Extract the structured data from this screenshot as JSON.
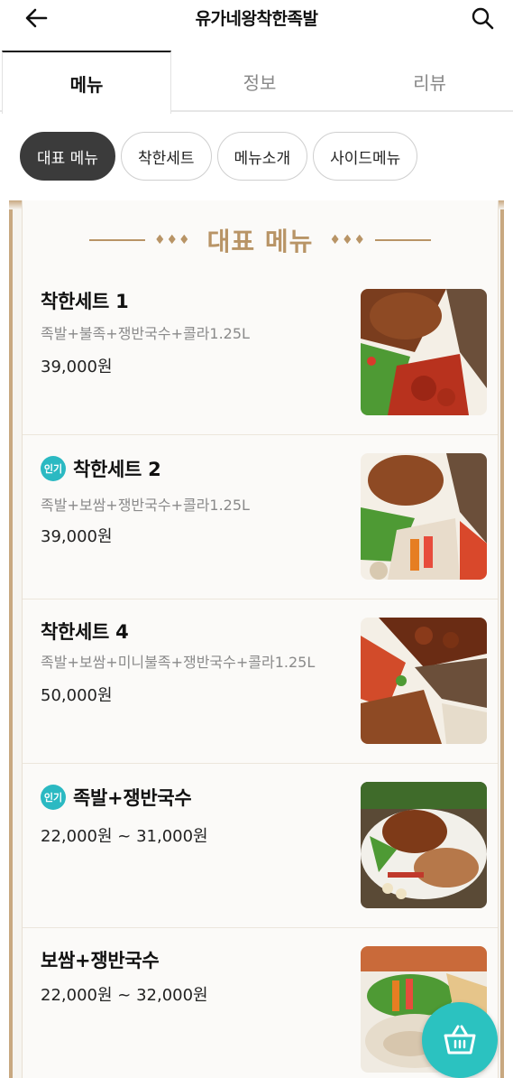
{
  "header": {
    "title": "유가네왕착한족발"
  },
  "tabs": [
    {
      "label": "메뉴",
      "active": true
    },
    {
      "label": "정보",
      "active": false
    },
    {
      "label": "리뷰",
      "active": false
    }
  ],
  "chips": [
    {
      "label": "대표 메뉴",
      "active": true
    },
    {
      "label": "착한세트",
      "active": false
    },
    {
      "label": "메뉴소개",
      "active": false
    },
    {
      "label": "사이드메뉴",
      "active": false
    }
  ],
  "section": {
    "title": "대표 메뉴",
    "ornament": "♦♦♦"
  },
  "menu": [
    {
      "name": "착한세트 1",
      "popular": false,
      "desc": "족발+불족+쟁반국수+콜라1.25L",
      "price": "39,000원"
    },
    {
      "name": "착한세트 2",
      "popular": true,
      "desc": "족발+보쌈+쟁반국수+콜라1.25L",
      "price": "39,000원"
    },
    {
      "name": "착한세트 4",
      "popular": false,
      "desc": "족발+보쌈+미니불족+쟁반국수+콜라1.25L",
      "price": "50,000원"
    },
    {
      "name": "족발+쟁반국수",
      "popular": true,
      "desc": "",
      "price": "22,000원 ~ 31,000원"
    },
    {
      "name": "보쌈+쟁반국수",
      "popular": false,
      "desc": "",
      "price": "22,000원 ~ 32,000원"
    }
  ],
  "badge_label": "인기",
  "colors": {
    "accent": "#2bc2c0",
    "gold": "#b89466",
    "chip_active": "#3b3b3b"
  },
  "icons": {
    "back": "arrow-left-icon",
    "search": "search-icon",
    "cart": "basket-icon"
  }
}
